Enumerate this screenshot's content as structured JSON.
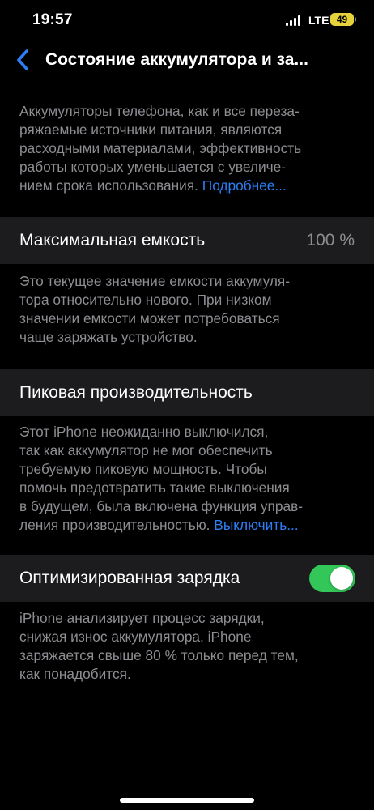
{
  "status": {
    "time": "19:57",
    "network": "LTE",
    "battery": "49",
    "battery_color": "#e6d23a"
  },
  "nav": {
    "back_icon": "chevron-left-icon",
    "title": "Состояние аккумулятора и за..."
  },
  "intro": {
    "text": "Аккумуляторы телефона, как и все переза-\nряжаемые источники питания, являются\nрасходными материалами, эффективность\nработы которых уменьшается с увеличе-\nнием срока использования. ",
    "link": "Подробнее..."
  },
  "max_capacity": {
    "label": "Максимальная емкость",
    "value": "100 %",
    "footer": "Это текущее значение емкости аккумуля-\nтора относительно нового. При низком\nзначении емкости может потребоваться\nчаще заряжать устройство."
  },
  "peak": {
    "label": "Пиковая производительность",
    "footer": "Этот iPhone неожиданно выключился,\nтак как аккумулятор не мог обеспечить\nтребуемую пиковую мощность. Чтобы\nпомочь предотвратить такие выключения\nв будущем, была включена функция управ-\nления производительностью. ",
    "link": "Выключить..."
  },
  "optimized": {
    "label": "Оптимизированная зарядка",
    "toggle_on": true,
    "toggle_color": "#33c759",
    "footer": "iPhone анализирует процесс зарядки,\nснижая износ аккумулятора. iPhone\nзаряжается свыше 80 % только перед тем,\nкак понадобится."
  },
  "colors": {
    "link": "#2b7ef5",
    "cell_bg": "#1c1c1e",
    "secondary_text": "#8d8d92"
  }
}
